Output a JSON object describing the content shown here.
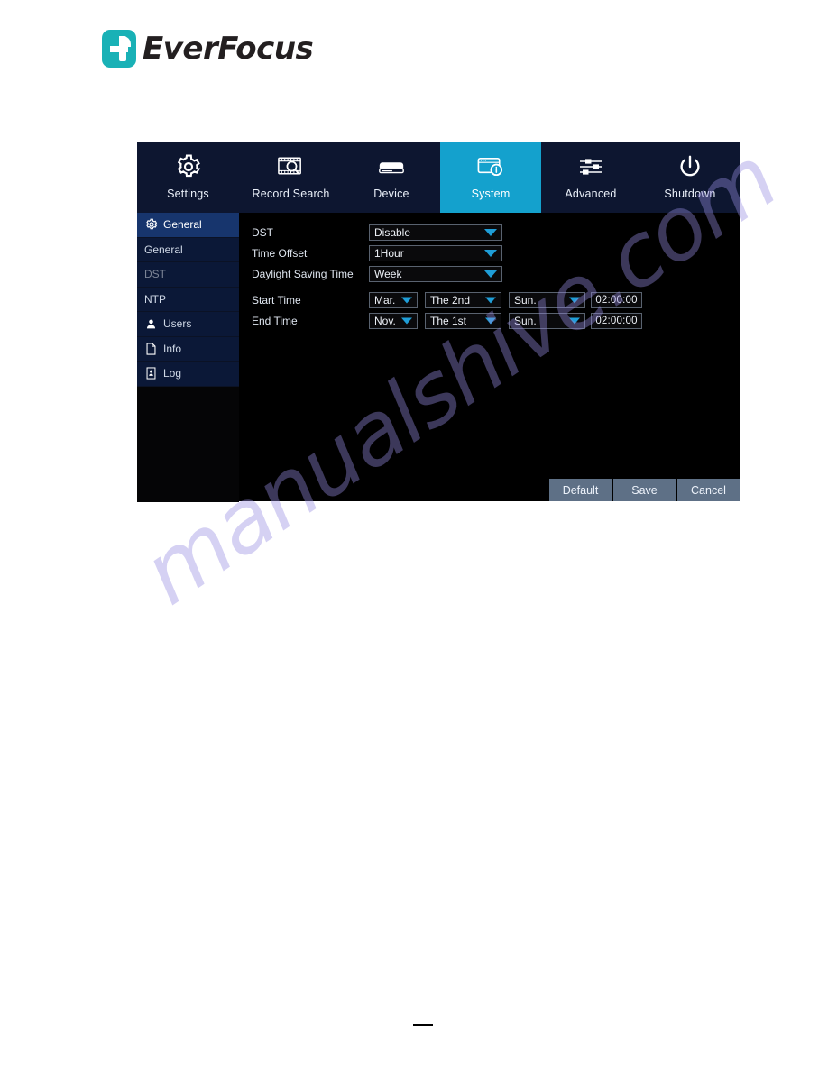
{
  "brand": {
    "logo_icon": "everfocus-f-logo-icon",
    "name": "EverFocus"
  },
  "dvr": {
    "tabs": [
      {
        "id": "settings",
        "label": "Settings",
        "icon": "gear-icon",
        "active": false
      },
      {
        "id": "record-search",
        "label": "Record Search",
        "icon": "film-search-icon",
        "active": false
      },
      {
        "id": "device",
        "label": "Device",
        "icon": "hard-drive-icon",
        "active": false
      },
      {
        "id": "system",
        "label": "System",
        "icon": "monitor-info-icon",
        "active": true
      },
      {
        "id": "advanced",
        "label": "Advanced",
        "icon": "sliders-icon",
        "active": false
      },
      {
        "id": "shutdown",
        "label": "Shutdown",
        "icon": "power-icon",
        "active": false
      }
    ],
    "sidebar": [
      {
        "id": "general-head",
        "label": "General",
        "icon": "gear-icon",
        "state": "header"
      },
      {
        "id": "general",
        "label": "General",
        "icon": "none",
        "state": "normal"
      },
      {
        "id": "dst",
        "label": "DST",
        "icon": "none",
        "state": "dim"
      },
      {
        "id": "ntp",
        "label": "NTP",
        "icon": "none",
        "state": "normal"
      },
      {
        "id": "users",
        "label": "Users",
        "icon": "user-icon",
        "state": "normal"
      },
      {
        "id": "info",
        "label": "Info",
        "icon": "document-icon",
        "state": "normal"
      },
      {
        "id": "log",
        "label": "Log",
        "icon": "log-card-icon",
        "state": "normal"
      }
    ],
    "form": {
      "dst": {
        "label": "DST",
        "value": "Disable"
      },
      "time_offset": {
        "label": "Time Offset",
        "value": "1Hour"
      },
      "daylight_saving_time": {
        "label": "Daylight Saving Time",
        "value": "Week"
      },
      "start_time": {
        "label": "Start Time",
        "month": "Mar.",
        "ordinal": "The 2nd",
        "weekday": "Sun.",
        "time": "02:00:00"
      },
      "end_time": {
        "label": "End Time",
        "month": "Nov.",
        "ordinal": "The 1st",
        "weekday": "Sun.",
        "time": "02:00:00"
      }
    },
    "buttons": {
      "default": "Default",
      "save": "Save",
      "cancel": "Cancel"
    }
  },
  "watermark": {
    "text": "manualshive.com"
  },
  "colors": {
    "accent_teal": "#19b1b6",
    "tab_active": "#14a1cd",
    "tab_bar_bg": "#0d1630",
    "sidebar_item_bg": "#0b1837",
    "sidebar_header_bg": "#17356d",
    "panel_bg": "#000000",
    "button_bg": "#5e7086",
    "caret_blue": "#1f9ed8"
  }
}
